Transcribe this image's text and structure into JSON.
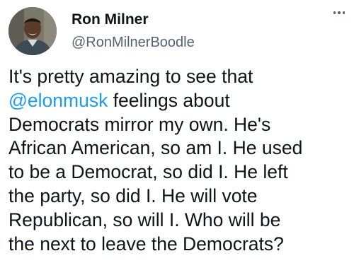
{
  "author": {
    "display_name": "Ron Milner",
    "handle": "@RonMilnerBoodle",
    "avatar_icon": "profile-photo-icon"
  },
  "menu": {
    "icon": "more-options-icon"
  },
  "tweet": {
    "mention": "@elonmusk",
    "lines": {
      "l1": "It's pretty amazing to see that",
      "l2_after_mention": " feelings about",
      "l3": "Democrats mirror my own. He's",
      "l4": "African American, so am I. He used",
      "l5": "to be a Democrat, so did I. He left",
      "l6": "the party, so did I. He will vote",
      "l7": "Republican, so will I. Who will be",
      "l8": "the next to leave the Democrats?"
    }
  },
  "colors": {
    "text": "#0f1419",
    "secondary": "#536471",
    "link": "#1d9bf0",
    "background": "#ffffff"
  }
}
